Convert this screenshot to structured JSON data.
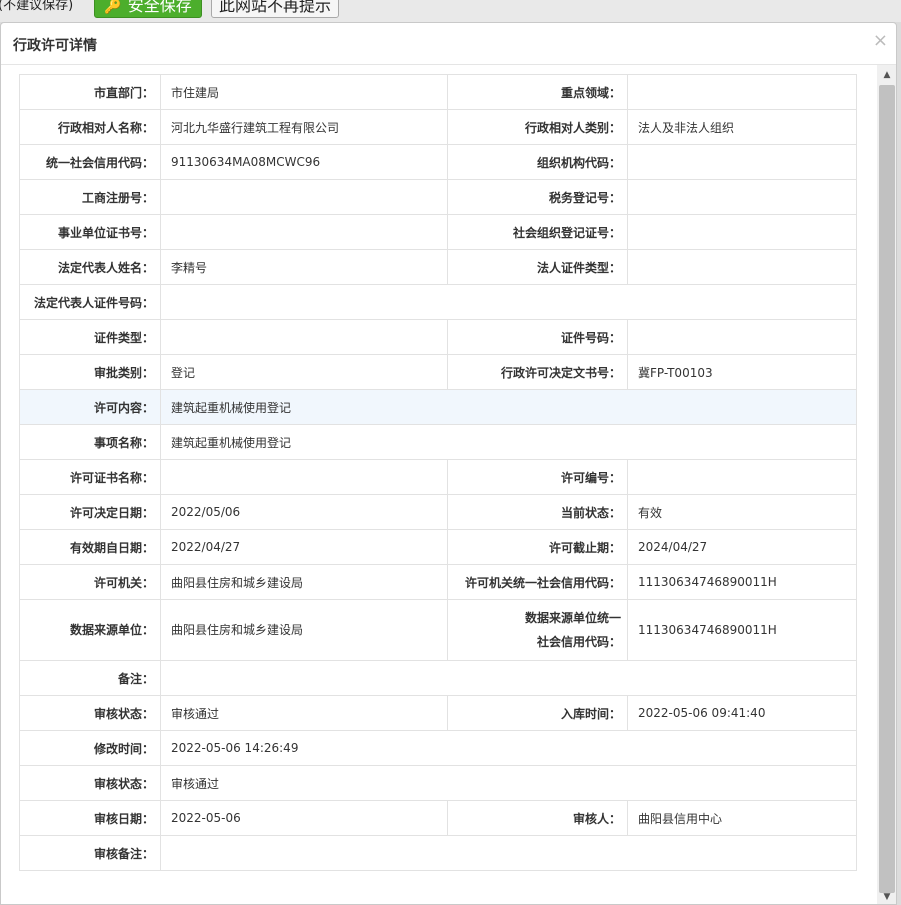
{
  "prompt_bar": {
    "note": "(不建议保存)",
    "safe_save_label": "安全保存",
    "dismiss_label": "此网站不再提示"
  },
  "dialog": {
    "title": "行政许可详情",
    "close": "×"
  },
  "rows": [
    {
      "l1": "市直部门：",
      "v1": "市住建局",
      "l2": "重点领域：",
      "v2": ""
    },
    {
      "l1": "行政相对人名称：",
      "v1": "河北九华盛行建筑工程有限公司",
      "l2": "行政相对人类别：",
      "v2": "法人及非法人组织"
    },
    {
      "l1": "统一社会信用代码：",
      "v1": "91130634MA08MCWC96",
      "l2": "组织机构代码：",
      "v2": ""
    },
    {
      "l1": "工商注册号：",
      "v1": "",
      "l2": "税务登记号：",
      "v2": ""
    },
    {
      "l1": "事业单位证书号：",
      "v1": "",
      "l2": "社会组织登记证号：",
      "v2": ""
    },
    {
      "l1": "法定代表人姓名：",
      "v1": "李精号",
      "l2": "法人证件类型：",
      "v2": ""
    },
    {
      "l1": "法定代表人证件号码：",
      "v1": ""
    },
    {
      "l1": "证件类型：",
      "v1": "",
      "l2": "证件号码：",
      "v2": ""
    },
    {
      "l1": "审批类别：",
      "v1": "登记",
      "l2": "行政许可决定文书号：",
      "v2": "冀FP-T00103"
    },
    {
      "l1": "许可内容：",
      "v1": "建筑起重机械使用登记"
    },
    {
      "l1": "事项名称：",
      "v1": "建筑起重机械使用登记"
    },
    {
      "l1": "许可证书名称：",
      "v1": "",
      "l2": "许可编号：",
      "v2": ""
    },
    {
      "l1": "许可决定日期：",
      "v1": "2022/05/06",
      "l2": "当前状态：",
      "v2": "有效"
    },
    {
      "l1": "有效期自日期：",
      "v1": "2022/04/27",
      "l2": "许可截止期：",
      "v2": "2024/04/27"
    },
    {
      "l1": "许可机关：",
      "v1": "曲阳县住房和城乡建设局",
      "l2": "许可机关统一社会信用代码：",
      "v2": "11130634746890011H"
    },
    {
      "l1": "数据来源单位：",
      "v1": "曲阳县住房和城乡建设局",
      "l2a": "数据来源单位统一",
      "l2b": "社会信用代码：",
      "v2": "11130634746890011H"
    },
    {
      "l1": "备注：",
      "v1": ""
    },
    {
      "l1": "审核状态：",
      "v1": "审核通过",
      "l2": "入库时间：",
      "v2": "2022-05-06 09:41:40"
    },
    {
      "l1": "修改时间：",
      "v1": "2022-05-06 14:26:49"
    },
    {
      "l1": "审核状态：",
      "v1": "审核通过"
    },
    {
      "l1": "审核日期：",
      "v1": "2022-05-06",
      "l2": "审核人：",
      "v2": "曲阳县信用中心"
    },
    {
      "l1": "审核备注：",
      "v1": ""
    }
  ]
}
